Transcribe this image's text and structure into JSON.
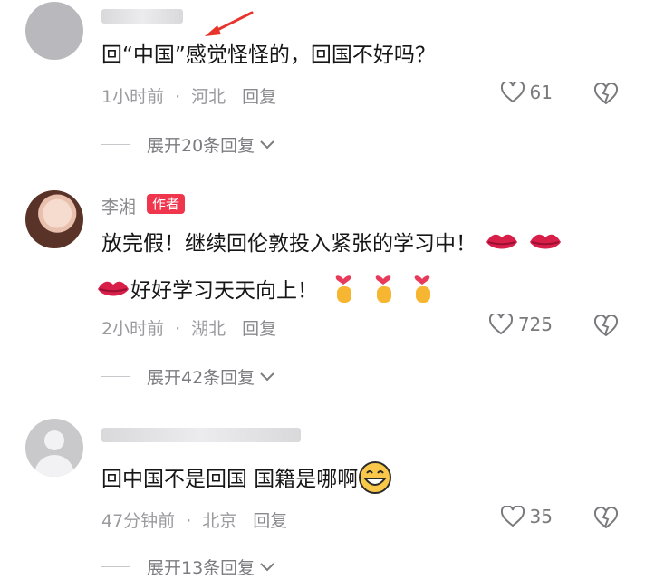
{
  "comments": [
    {
      "text": "回“中国”感觉怪怪的，回国不好吗？",
      "time": "1小时前",
      "location": "河北",
      "reply_label": "回复",
      "likes": "61",
      "expand_label": "展开20条回复"
    },
    {
      "author": "李湘",
      "author_badge": "作者",
      "text_line1": "放完假！继续回伦敦投入紧张的学习中！",
      "text_line2": "好好学习天天向上！",
      "time": "2小时前",
      "location": "湖北",
      "reply_label": "回复",
      "likes": "725",
      "expand_label": "展开42条回复"
    },
    {
      "text": "回中国不是回国 国籍是哪啊",
      "time": "47分钟前",
      "location": "北京",
      "reply_label": "回复",
      "likes": "35",
      "expand_label": "展开13条回复"
    }
  ],
  "colors": {
    "badge": "#f0364d",
    "annotation_arrow": "#e8352c",
    "meta_text": "#9b9b9f"
  },
  "icons": [
    "heart-outline-icon",
    "broken-heart-icon",
    "chevron-down-icon",
    "kiss-lips-emoji",
    "finger-heart-emoji",
    "grin-emoji"
  ]
}
